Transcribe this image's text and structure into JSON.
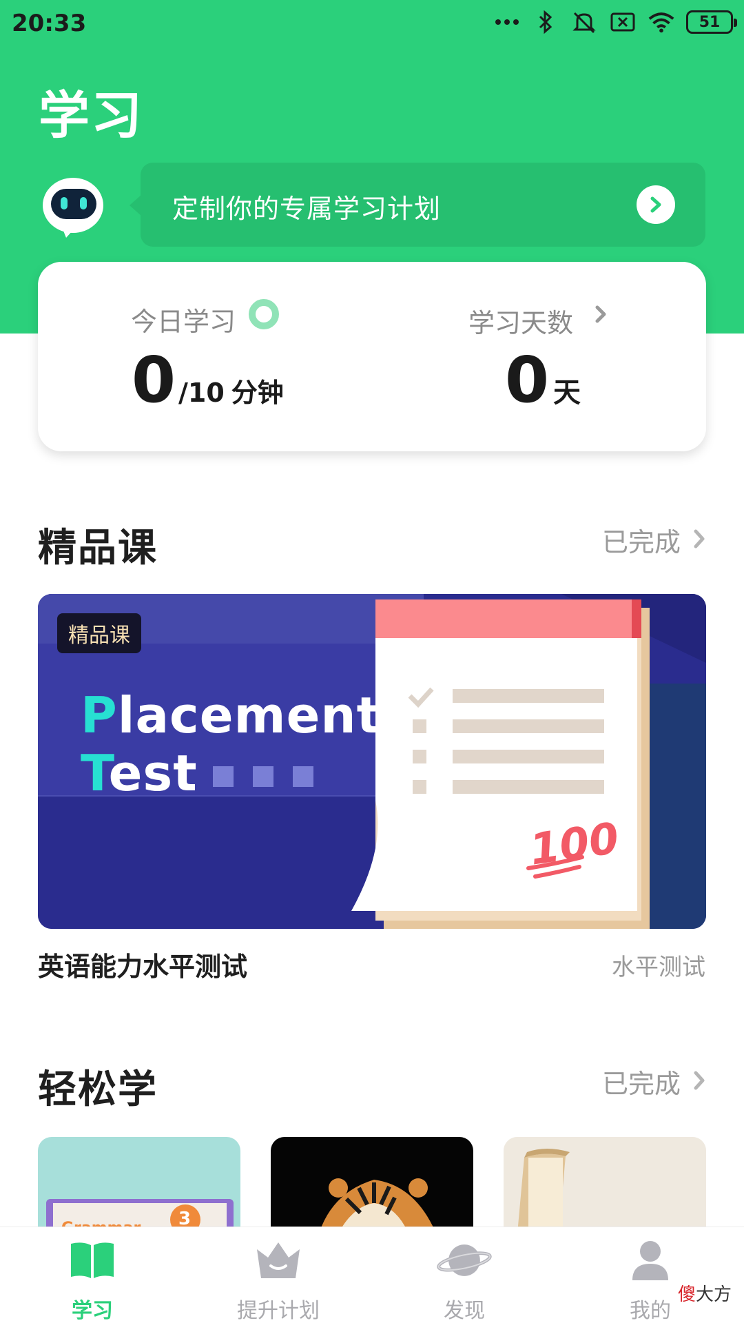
{
  "status_bar": {
    "time": "20:33",
    "battery": "51",
    "icons": [
      "more-dots-icon",
      "bluetooth-icon",
      "mute-icon",
      "sim-x-icon",
      "wifi-icon",
      "battery-icon"
    ]
  },
  "header": {
    "title": "学习",
    "plan_banner_text": "定制你的专属学习计划",
    "robot_icon": "robot-mascot-icon",
    "arrow_icon": "arrow-right-circle-icon"
  },
  "stats": {
    "today_label": "今日学习",
    "today_value": "0",
    "today_goal": "/10",
    "today_unit": "分钟",
    "days_label": "学习天数",
    "days_value": "0",
    "days_unit": "天"
  },
  "premium_section": {
    "title": "精品课",
    "link": "已完成",
    "course": {
      "badge": "精品课",
      "banner_line1_accent": "P",
      "banner_line1_rest": "lacement",
      "banner_line2_accent": "T",
      "banner_line2_rest": "est",
      "score": "100",
      "name": "英语能力水平测试",
      "tag": "水平测试"
    }
  },
  "easy_section": {
    "title": "轻松学",
    "link": "已完成",
    "thumbnails": [
      {
        "image": "grammar-book-image",
        "text": "Grammar",
        "number": "3"
      },
      {
        "image": "tiger-image"
      },
      {
        "image": "open-book-image"
      }
    ]
  },
  "bottom_nav": {
    "items": [
      {
        "label": "学习",
        "icon": "book-icon",
        "active": true
      },
      {
        "label": "提升计划",
        "icon": "crown-icon",
        "active": false
      },
      {
        "label": "发现",
        "icon": "planet-icon",
        "active": false
      },
      {
        "label": "我的",
        "icon": "person-icon",
        "active": false
      }
    ]
  },
  "watermark": {
    "red": "傻",
    "rest": "大方"
  },
  "colors": {
    "brand_green": "#2bd07b",
    "banner_blue": "#2a2c8e",
    "accent_cyan": "#27e0d2",
    "gray_text": "#9a9a9a"
  }
}
